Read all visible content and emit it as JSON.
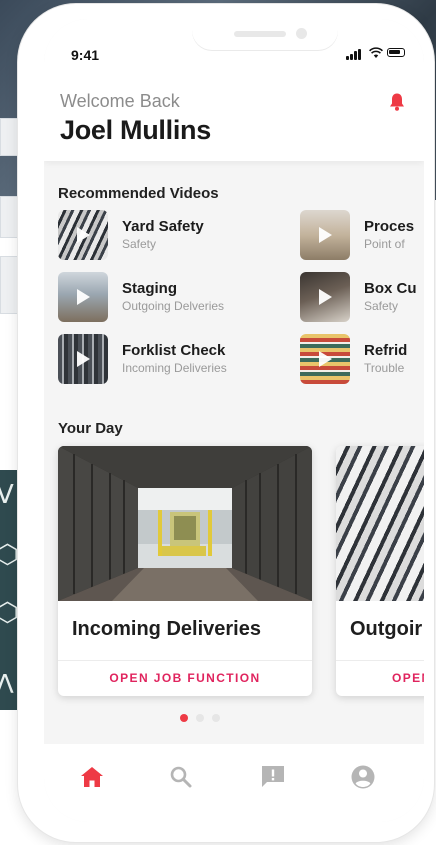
{
  "status_bar": {
    "time": "9:41"
  },
  "header": {
    "welcome": "Welcome Back",
    "user_name": "Joel Mullins"
  },
  "recommended": {
    "title": "Recommended Videos",
    "videos": [
      {
        "title": "Yard Safety",
        "subtitle": "Safety",
        "thumb": "trailers-aerial"
      },
      {
        "title": "Staging",
        "subtitle": "Outgoing Delveries",
        "thumb": "warehouse-dock"
      },
      {
        "title": "Forklist Check",
        "subtitle": "Incoming Deliveries",
        "thumb": "warehouse-aisle"
      },
      {
        "title": "Proces",
        "subtitle": "Point of",
        "thumb": "worker-office"
      },
      {
        "title": "Box Cu",
        "subtitle": "Safety",
        "thumb": "hands-box"
      },
      {
        "title": "Refrid",
        "subtitle": "Trouble",
        "thumb": "store-shelves"
      }
    ]
  },
  "your_day": {
    "title": "Your Day",
    "cards": [
      {
        "title": "Incoming Deliveries",
        "action": "OPEN JOB FUNCTION"
      },
      {
        "title": "Outgoir",
        "action": "OPEN"
      }
    ],
    "pagination": {
      "pages": 3,
      "active": 0
    }
  },
  "tabbar": {
    "items": [
      "home-icon",
      "search-icon",
      "feedback-icon",
      "profile-icon"
    ],
    "active": "home-icon"
  },
  "colors": {
    "accent": "#ee3a45",
    "action": "#e0245e"
  }
}
